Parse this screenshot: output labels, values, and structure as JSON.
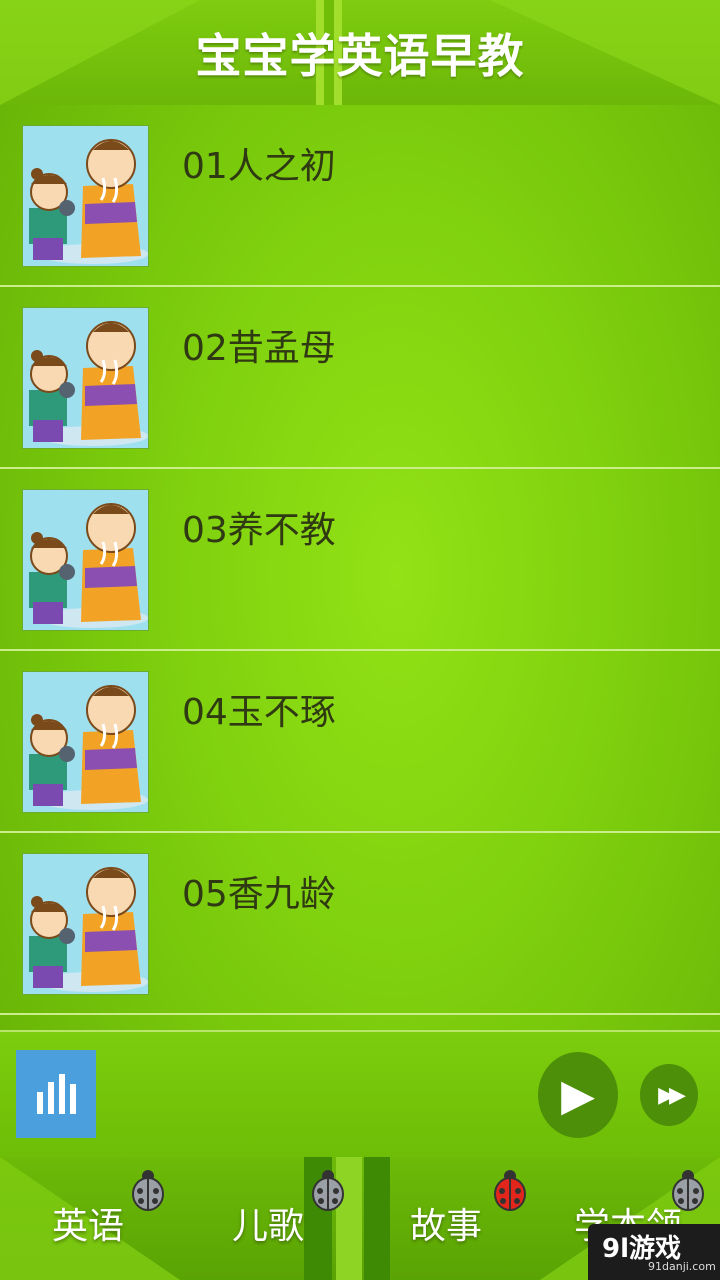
{
  "app": {
    "title": "宝宝学英语早教"
  },
  "lessons": [
    {
      "label": "01人之初"
    },
    {
      "label": "02昔孟母"
    },
    {
      "label": "03养不教"
    },
    {
      "label": "04玉不琢"
    },
    {
      "label": "05香九龄"
    }
  ],
  "player": {
    "eq_icon": "equalizer-icon",
    "play_icon": "play-icon",
    "play_glyph": "▶",
    "ff_icon": "fast-forward-icon",
    "ff_glyph": "▶▶"
  },
  "nav": {
    "tabs": [
      {
        "label": "英语",
        "bug": "grey"
      },
      {
        "label": "儿歌",
        "bug": "grey"
      },
      {
        "label": "故事",
        "bug": "red"
      },
      {
        "label": "学本领",
        "bug": "grey"
      }
    ]
  },
  "watermark": {
    "main": "9l游戏",
    "sub": "91danji.com"
  },
  "colors": {
    "accent": "#7fd00e",
    "play": "#4d8f08",
    "eq": "#4a9fdc"
  }
}
